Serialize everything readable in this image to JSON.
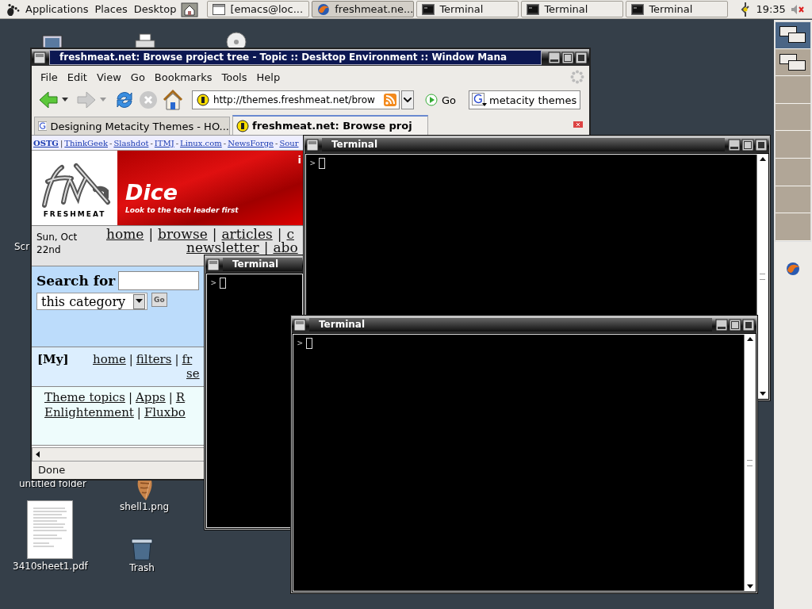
{
  "top_panel": {
    "menus": [
      "Applications",
      "Places",
      "Desktop"
    ],
    "tasks": [
      {
        "label": "[emacs@loc...",
        "kind": "window",
        "selected": false
      },
      {
        "label": "freshmeat.ne...",
        "kind": "browser",
        "selected": true
      },
      {
        "label": "Terminal",
        "kind": "terminal",
        "selected": false
      },
      {
        "label": "Terminal",
        "kind": "terminal",
        "selected": false
      },
      {
        "label": "Terminal",
        "kind": "terminal",
        "selected": false
      }
    ],
    "clock": "19:35"
  },
  "desktop_icons": [
    {
      "kind": "computer"
    },
    {
      "kind": "printer"
    },
    {
      "kind": "disc"
    },
    {
      "kind": "label",
      "label": "Scr"
    },
    {
      "kind": "label",
      "label": "untitled folder"
    },
    {
      "label": "shell1.png"
    },
    {
      "kind": "document",
      "label": "3410sheet1.pdf"
    },
    {
      "kind": "trash",
      "label": "Trash"
    }
  ],
  "workspaces": [
    {
      "selected": true,
      "kind": "windows"
    },
    {
      "selected": false,
      "kind": "windows"
    },
    {
      "selected": false,
      "kind": "empty"
    },
    {
      "selected": false,
      "kind": "empty"
    },
    {
      "selected": false,
      "kind": "empty"
    },
    {
      "selected": false,
      "kind": "empty"
    },
    {
      "selected": false,
      "kind": "empty"
    },
    {
      "selected": false,
      "kind": "empty"
    }
  ],
  "browser": {
    "title": "freshmeat.net: Browse project tree - Topic :: Desktop Environment :: Window Mana",
    "menu": [
      "File",
      "Edit",
      "View",
      "Go",
      "Bookmarks",
      "Tools",
      "Help"
    ],
    "url": "http://themes.freshmeat.net/brow",
    "go": "Go",
    "search": "metacity themes",
    "tabs": [
      {
        "label": "Designing Metacity Themes - HO...",
        "selected": false
      },
      {
        "label": "freshmeat.net: Browse proj",
        "selected": true
      }
    ],
    "page": {
      "site_links": [
        {
          "text": "OSTG",
          "kind": "bold"
        },
        {
          "text": "|",
          "kind": "sep"
        },
        {
          "text": "ThinkGeek",
          "kind": "link"
        },
        {
          "text": "-",
          "kind": "sep"
        },
        {
          "text": "Slashdot",
          "kind": "link"
        },
        {
          "text": "-",
          "kind": "sep"
        },
        {
          "text": "ITMJ",
          "kind": "link"
        },
        {
          "text": "-",
          "kind": "sep"
        },
        {
          "text": "Linux.com",
          "kind": "link"
        },
        {
          "text": "-",
          "kind": "sep"
        },
        {
          "text": "NewsForge",
          "kind": "link"
        },
        {
          "text": "-",
          "kind": "sep"
        },
        {
          "text": "Sour",
          "kind": "link"
        }
      ],
      "logo_text": "FRESHMEAT",
      "ad": {
        "brand": "Dice",
        "tagline": "Look to the tech leader first",
        "fragment": "i"
      },
      "date": "Sun, Oct 22nd",
      "separator": "|",
      "nav_lines": [
        [
          "home",
          "browse",
          "articles",
          "c"
        ],
        [
          "newsletter",
          "abo"
        ]
      ],
      "search_label": "Search for",
      "category": "this category",
      "search_button": "Go",
      "my_label": "[My]",
      "my_lines": [
        [
          "home",
          "filters",
          "fr"
        ],
        [
          "se"
        ]
      ],
      "topic_lines": [
        [
          "Theme topics",
          "Apps",
          "R"
        ],
        [
          "Enlightenment",
          "Fluxbo"
        ]
      ]
    },
    "status": "Done"
  },
  "terminals": [
    {
      "title": "Terminal",
      "prompt": ">",
      "kind": "full"
    },
    {
      "title": "Terminal",
      "prompt": ">",
      "kind": "covered"
    },
    {
      "title": "Terminal",
      "prompt": ">",
      "kind": "full"
    }
  ]
}
